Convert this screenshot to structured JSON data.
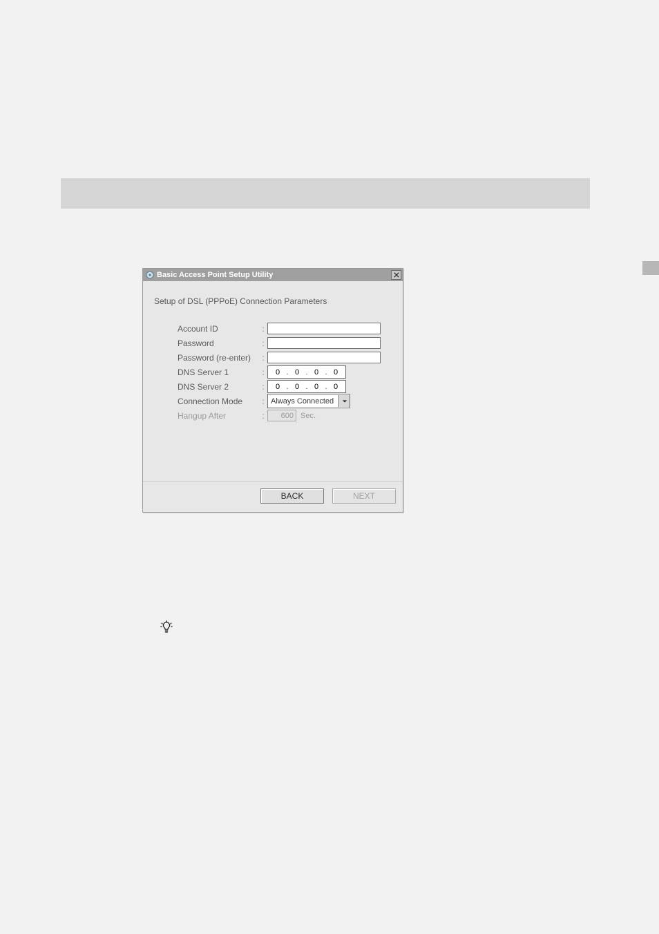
{
  "dialog": {
    "title": "Basic Access Point Setup Utility",
    "subtitle": "Setup of DSL (PPPoE) Connection Parameters"
  },
  "form": {
    "account_id": {
      "label": "Account ID",
      "value": ""
    },
    "password": {
      "label": "Password",
      "value": ""
    },
    "password_re": {
      "label": "Password (re-enter)",
      "value": ""
    },
    "dns1": {
      "label": "DNS Server 1",
      "oct": [
        "0",
        "0",
        "0",
        "0"
      ]
    },
    "dns2": {
      "label": "DNS Server 2",
      "oct": [
        "0",
        "0",
        "0",
        "0"
      ]
    },
    "connection_mode": {
      "label": "Connection Mode",
      "value": "Always Connected"
    },
    "hangup_after": {
      "label": "Hangup After",
      "value": "600",
      "unit": "Sec."
    }
  },
  "footer": {
    "back_label": "BACK",
    "next_label": "NEXT"
  }
}
